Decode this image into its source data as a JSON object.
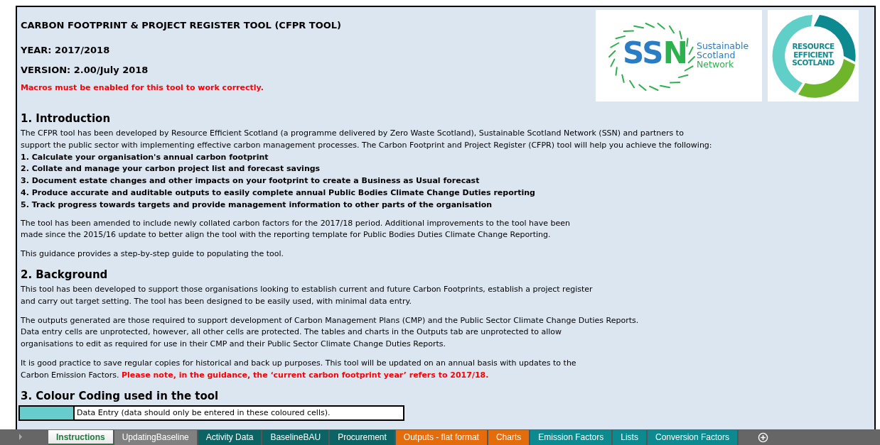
{
  "header": {
    "title": "CARBON FOOTPRINT & PROJECT REGISTER TOOL (CFPR TOOL)",
    "year": "YEAR: 2017/2018",
    "version": "VERSION: 2.00/July 2018",
    "warning": "Macros must be enabled for this tool to work correctly."
  },
  "logos": {
    "ssn": {
      "mark": "SSN",
      "words": [
        "Sustainable",
        "Scotland",
        "Network"
      ]
    },
    "res": {
      "words": [
        "RESOURCE",
        "EFFICIENT",
        "SCOTLAND"
      ]
    }
  },
  "sections": [
    {
      "heading": "1. Introduction",
      "blocks": [
        {
          "kind": "para",
          "lines": [
            "The CFPR tool has been developed by Resource Efficient Scotland (a programme delivered by Zero Waste Scotland), Sustainable Scotland Network (SSN) and partners to",
            "support the public sector with implementing effective carbon management processes. The Carbon Footprint and Project Register (CFPR) tool will help you achieve the following:"
          ]
        },
        {
          "kind": "list",
          "lines": [
            "1. Calculate your organisation's annual carbon footprint",
            "2. Collate and manage your carbon project list and forecast savings",
            "3. Document estate changes and other impacts on your footprint to create a Business as Usual forecast",
            "4. Produce accurate and auditable outputs to easily complete annual Public Bodies Climate Change Duties reporting",
            "5. Track progress towards targets and provide management information to other parts of the organisation"
          ]
        },
        {
          "kind": "para",
          "lines": [
            "The tool has been amended to include newly collated carbon factors for the 2017/18 period. Additional improvements to the tool have been",
            "made since the 2015/16 update to better align the tool with the reporting template for Public Bodies Duties Climate Change Reporting."
          ]
        },
        {
          "kind": "para",
          "lines": [
            "This guidance provides a step-by-step guide to populating the tool."
          ]
        }
      ]
    },
    {
      "heading": "2. Background",
      "blocks": [
        {
          "kind": "para",
          "lines": [
            "This tool has been developed to support those organisations looking to establish current and future Carbon Footprints, establish a project register",
            "and carry out target setting. The tool has been designed to be easily used, with minimal data entry."
          ]
        },
        {
          "kind": "para",
          "lines": [
            "The outputs generated are those required to support development of Carbon Management Plans (CMP) and the Public Sector Climate Change Duties Reports.",
            "Data entry cells are unprotected, however, all other cells are protected. The tables and charts in the Outputs tab are unprotected to allow",
            "organisations to edit as required for use in their CMP and their Public Sector Climate Change Duties Reports."
          ]
        },
        {
          "kind": "para",
          "lines": [
            "It is good practice to save regular copies for historical and back up purposes. This tool will be updated on an annual basis with updates to the",
            "Carbon Emission Factors. **Please note, in the guidance,  the ‘current carbon footprint year’ refers to 2017/18.**"
          ]
        }
      ]
    },
    {
      "heading": "3. Colour Coding used in the tool",
      "blocks": [
        {
          "kind": "legend",
          "color": "#66cccc",
          "label": "Data Entry (data should only be entered in these coloured cells)."
        }
      ]
    }
  ],
  "sheet_tabs": [
    {
      "label": "Instructions",
      "selected": true,
      "color": "#ffffff"
    },
    {
      "label": "UpdatingBaseline",
      "selected": false,
      "color": "#808080"
    },
    {
      "label": "Activity Data",
      "selected": false,
      "color": "#0b6363"
    },
    {
      "label": "BaselineBAU",
      "selected": false,
      "color": "#0b6363"
    },
    {
      "label": "Procurement",
      "selected": false,
      "color": "#0b6363"
    },
    {
      "label": "Outputs - flat format",
      "selected": false,
      "color": "#e46c0a"
    },
    {
      "label": "Charts",
      "selected": false,
      "color": "#e46c0a"
    },
    {
      "label": "Emission Factors",
      "selected": false,
      "color": "#0d8a8f"
    },
    {
      "label": "Lists",
      "selected": false,
      "color": "#0d8a8f"
    },
    {
      "label": "Conversion Factors",
      "selected": false,
      "color": "#0d8a8f"
    }
  ]
}
